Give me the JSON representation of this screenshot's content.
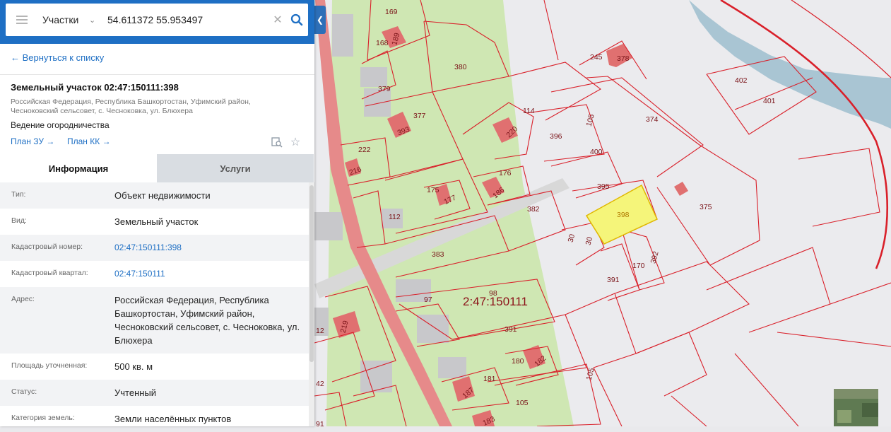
{
  "search": {
    "mode": "Участки",
    "query": "54.611372 55.953497"
  },
  "back_link": "← Вернуться к списку",
  "parcel": {
    "title": "Земельный участок 02:47:150111:398",
    "address_short": "Российская Федерация, Республика Башкортостан, Уфимский район, Чесноковский сельсовет, с. Чесноковка, ул. Блюхера",
    "purpose": "Ведение огородничества",
    "plan_zu": "План ЗУ →",
    "plan_kk": "План КК →"
  },
  "tabs": {
    "info": "Информация",
    "services": "Услуги"
  },
  "info": [
    {
      "key": "Тип:",
      "value": "Объект недвижимости"
    },
    {
      "key": "Вид:",
      "value": "Земельный участок"
    },
    {
      "key": "Кадастровый номер:",
      "value": "02:47:150111:398"
    },
    {
      "key": "Кадастровый квартал:",
      "value": "02:47:150111"
    },
    {
      "key": "Адрес:",
      "value": "Российская Федерация, Республика Башкортостан, Уфимский район, Чесноковский сельсовет, с. Чесноковка, ул. Блюхера"
    },
    {
      "key": "Площадь уточненная:",
      "value": "500 кв. м"
    },
    {
      "key": "Статус:",
      "value": "Учтенный"
    },
    {
      "key": "Категория земель:",
      "value": "Земли населённых пунктов"
    }
  ],
  "map": {
    "quarter_label": "2:47:150111",
    "selected_parcel": "398",
    "labels": [
      "169",
      "168",
      "189",
      "380",
      "379",
      "377",
      "393",
      "114",
      "220",
      "396",
      "245",
      "378",
      "402",
      "401",
      "374",
      "222",
      "216",
      "176",
      "175",
      "177",
      "186",
      "400",
      "395",
      "375",
      "112",
      "382",
      "398",
      "30",
      "30",
      "383",
      "170",
      "392",
      "391",
      "97",
      "98",
      "391",
      "219",
      "12",
      "180",
      "182",
      "181",
      "187",
      "105",
      "42",
      "183",
      "105",
      "91",
      "105"
    ],
    "colors": {
      "selected_fill": "#f5f57a",
      "boundary": "#d9202a",
      "green_zone": "#cfe7b3",
      "building": "#e07070",
      "water": "#a9c5d3"
    }
  }
}
